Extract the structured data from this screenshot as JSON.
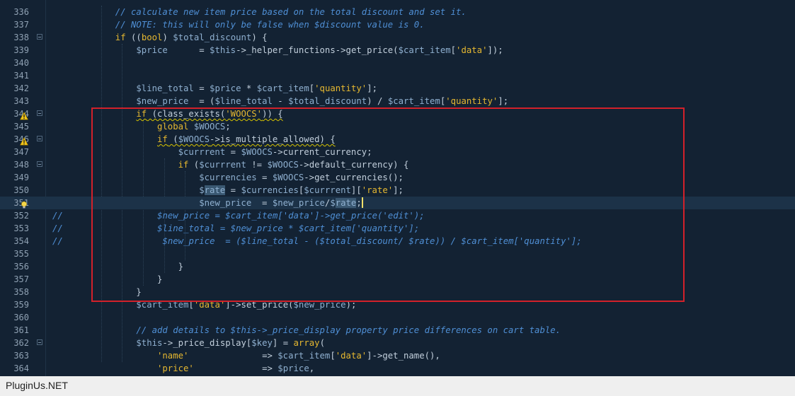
{
  "lines": [
    {
      "num": "336",
      "indent": 3,
      "tokens": [
        {
          "t": "// calculate new item price based on the total discount and set it.",
          "c": "cm"
        }
      ]
    },
    {
      "num": "337",
      "indent": 3,
      "tokens": [
        {
          "t": "// NOTE: this will only be false when $discount value is 0.",
          "c": "cm"
        }
      ]
    },
    {
      "num": "338",
      "indent": 3,
      "fold": true,
      "tokens": [
        {
          "t": "if",
          "c": "kw"
        },
        {
          "t": " ((",
          "c": "op"
        },
        {
          "t": "bool",
          "c": "kw"
        },
        {
          "t": ") ",
          "c": "op"
        },
        {
          "t": "$total_discount",
          "c": "var"
        },
        {
          "t": ") {",
          "c": "op"
        }
      ]
    },
    {
      "num": "339",
      "indent": 4,
      "tokens": [
        {
          "t": "$price",
          "c": "var"
        },
        {
          "t": "      = ",
          "c": "op"
        },
        {
          "t": "$this",
          "c": "var"
        },
        {
          "t": "->_helper_functions->get_price(",
          "c": "op"
        },
        {
          "t": "$cart_item",
          "c": "var"
        },
        {
          "t": "[",
          "c": "op"
        },
        {
          "t": "'data'",
          "c": "str"
        },
        {
          "t": "]);",
          "c": "op"
        }
      ]
    },
    {
      "num": "340",
      "indent": 0,
      "tokens": []
    },
    {
      "num": "341",
      "indent": 0,
      "tokens": []
    },
    {
      "num": "342",
      "indent": 4,
      "tokens": [
        {
          "t": "$line_total",
          "c": "var"
        },
        {
          "t": " = ",
          "c": "op"
        },
        {
          "t": "$price",
          "c": "var"
        },
        {
          "t": " * ",
          "c": "op"
        },
        {
          "t": "$cart_item",
          "c": "var"
        },
        {
          "t": "[",
          "c": "op"
        },
        {
          "t": "'quantity'",
          "c": "str"
        },
        {
          "t": "];",
          "c": "op"
        }
      ]
    },
    {
      "num": "343",
      "indent": 4,
      "tokens": [
        {
          "t": "$new_price",
          "c": "var"
        },
        {
          "t": "  = (",
          "c": "op"
        },
        {
          "t": "$line_total",
          "c": "var"
        },
        {
          "t": " - ",
          "c": "op"
        },
        {
          "t": "$total_discount",
          "c": "var"
        },
        {
          "t": ") / ",
          "c": "op"
        },
        {
          "t": "$cart_item",
          "c": "var"
        },
        {
          "t": "[",
          "c": "op"
        },
        {
          "t": "'quantity'",
          "c": "str"
        },
        {
          "t": "];",
          "c": "op"
        }
      ]
    },
    {
      "num": "344",
      "indent": 4,
      "fold": true,
      "marker": "warning",
      "squiggle": true,
      "tokens": [
        {
          "t": "if",
          "c": "kw"
        },
        {
          "t": " (class_exists(",
          "c": "op"
        },
        {
          "t": "'WOOCS'",
          "c": "str"
        },
        {
          "t": ")) {",
          "c": "op"
        }
      ]
    },
    {
      "num": "345",
      "indent": 5,
      "tokens": [
        {
          "t": "global",
          "c": "kw"
        },
        {
          "t": " ",
          "c": "op"
        },
        {
          "t": "$WOOCS",
          "c": "var"
        },
        {
          "t": ";",
          "c": "op"
        }
      ]
    },
    {
      "num": "346",
      "indent": 5,
      "fold": true,
      "marker": "warning",
      "squiggle": true,
      "tokens": [
        {
          "t": "if",
          "c": "kw"
        },
        {
          "t": " (",
          "c": "op"
        },
        {
          "t": "$WOOCS",
          "c": "var"
        },
        {
          "t": "->is_multiple_allowed) {",
          "c": "op"
        }
      ]
    },
    {
      "num": "347",
      "indent": 6,
      "tokens": [
        {
          "t": "$currrent",
          "c": "var"
        },
        {
          "t": " = ",
          "c": "op"
        },
        {
          "t": "$WOOCS",
          "c": "var"
        },
        {
          "t": "->current_currency;",
          "c": "op"
        }
      ]
    },
    {
      "num": "348",
      "indent": 6,
      "fold": true,
      "tokens": [
        {
          "t": "if",
          "c": "kw"
        },
        {
          "t": " (",
          "c": "op"
        },
        {
          "t": "$currrent",
          "c": "var"
        },
        {
          "t": " != ",
          "c": "op"
        },
        {
          "t": "$WOOCS",
          "c": "var"
        },
        {
          "t": "->default_currency) {",
          "c": "op"
        }
      ]
    },
    {
      "num": "349",
      "indent": 7,
      "tokens": [
        {
          "t": "$currencies",
          "c": "var"
        },
        {
          "t": " = ",
          "c": "op"
        },
        {
          "t": "$WOOCS",
          "c": "var"
        },
        {
          "t": "->get_currencies();",
          "c": "op"
        }
      ]
    },
    {
      "num": "350",
      "indent": 7,
      "tokens": [
        {
          "t": "$",
          "c": "var"
        },
        {
          "t": "rate",
          "c": "var",
          "hl": true
        },
        {
          "t": " = ",
          "c": "op"
        },
        {
          "t": "$currencies",
          "c": "var"
        },
        {
          "t": "[",
          "c": "op"
        },
        {
          "t": "$currrent",
          "c": "var"
        },
        {
          "t": "][",
          "c": "op"
        },
        {
          "t": "'rate'",
          "c": "str"
        },
        {
          "t": "];",
          "c": "op"
        }
      ]
    },
    {
      "num": "351",
      "indent": 7,
      "current": true,
      "marker": "bulb",
      "cursor": true,
      "tokens": [
        {
          "t": "$new_price",
          "c": "var"
        },
        {
          "t": "  = ",
          "c": "op"
        },
        {
          "t": "$new_price",
          "c": "var"
        },
        {
          "t": "/",
          "c": "op"
        },
        {
          "t": "$",
          "c": "var"
        },
        {
          "t": "rate",
          "c": "var",
          "hl": true
        },
        {
          "t": ";",
          "c": "op"
        }
      ]
    },
    {
      "num": "352",
      "indent": 0,
      "tokens": [
        {
          "t": "//                  $new_price = $cart_item['data']->get_price('edit');",
          "c": "cm"
        }
      ]
    },
    {
      "num": "353",
      "indent": 0,
      "tokens": [
        {
          "t": "//                  $line_total = $new_price * $cart_item['quantity'];",
          "c": "cm"
        }
      ]
    },
    {
      "num": "354",
      "indent": 0,
      "tokens": [
        {
          "t": "//                   $new_price  = ($line_total - ($total_discount/ $rate)) / $cart_item['quantity'];",
          "c": "cm"
        }
      ]
    },
    {
      "num": "355",
      "indent": 0,
      "tokens": []
    },
    {
      "num": "356",
      "indent": 6,
      "tokens": [
        {
          "t": "}",
          "c": "op"
        }
      ]
    },
    {
      "num": "357",
      "indent": 5,
      "tokens": [
        {
          "t": "}",
          "c": "op"
        }
      ]
    },
    {
      "num": "358",
      "indent": 4,
      "tokens": [
        {
          "t": "}",
          "c": "op"
        }
      ]
    },
    {
      "num": "359",
      "indent": 4,
      "tokens": [
        {
          "t": "$cart_item",
          "c": "var"
        },
        {
          "t": "[",
          "c": "op"
        },
        {
          "t": "'data'",
          "c": "str"
        },
        {
          "t": "]->set_price(",
          "c": "op"
        },
        {
          "t": "$new_price",
          "c": "var"
        },
        {
          "t": ");",
          "c": "op"
        }
      ]
    },
    {
      "num": "360",
      "indent": 0,
      "tokens": []
    },
    {
      "num": "361",
      "indent": 4,
      "tokens": [
        {
          "t": "// add details to $this->_price_display property price differences on cart table.",
          "c": "cm"
        }
      ]
    },
    {
      "num": "362",
      "indent": 4,
      "fold": true,
      "tokens": [
        {
          "t": "$this",
          "c": "var"
        },
        {
          "t": "->_price_display[",
          "c": "op"
        },
        {
          "t": "$key",
          "c": "var"
        },
        {
          "t": "] = ",
          "c": "op"
        },
        {
          "t": "array",
          "c": "kw"
        },
        {
          "t": "(",
          "c": "op"
        }
      ]
    },
    {
      "num": "363",
      "indent": 5,
      "tokens": [
        {
          "t": "'name'",
          "c": "str"
        },
        {
          "t": "              => ",
          "c": "op"
        },
        {
          "t": "$cart_item",
          "c": "var"
        },
        {
          "t": "[",
          "c": "op"
        },
        {
          "t": "'data'",
          "c": "str"
        },
        {
          "t": "]->get_name(),",
          "c": "op"
        }
      ]
    },
    {
      "num": "364",
      "indent": 5,
      "tokens": [
        {
          "t": "'price'",
          "c": "str"
        },
        {
          "t": "             => ",
          "c": "op"
        },
        {
          "t": "$price",
          "c": "var"
        },
        {
          "t": ",",
          "c": "op"
        }
      ]
    }
  ],
  "footer": {
    "label": "PluginUs.NET"
  },
  "colors": {
    "background": "#132233",
    "highlight_box": "#d2212a",
    "current_line": "#1c3248"
  },
  "icons": {
    "warning": "warning-icon",
    "bulb": "lightbulb-icon"
  }
}
